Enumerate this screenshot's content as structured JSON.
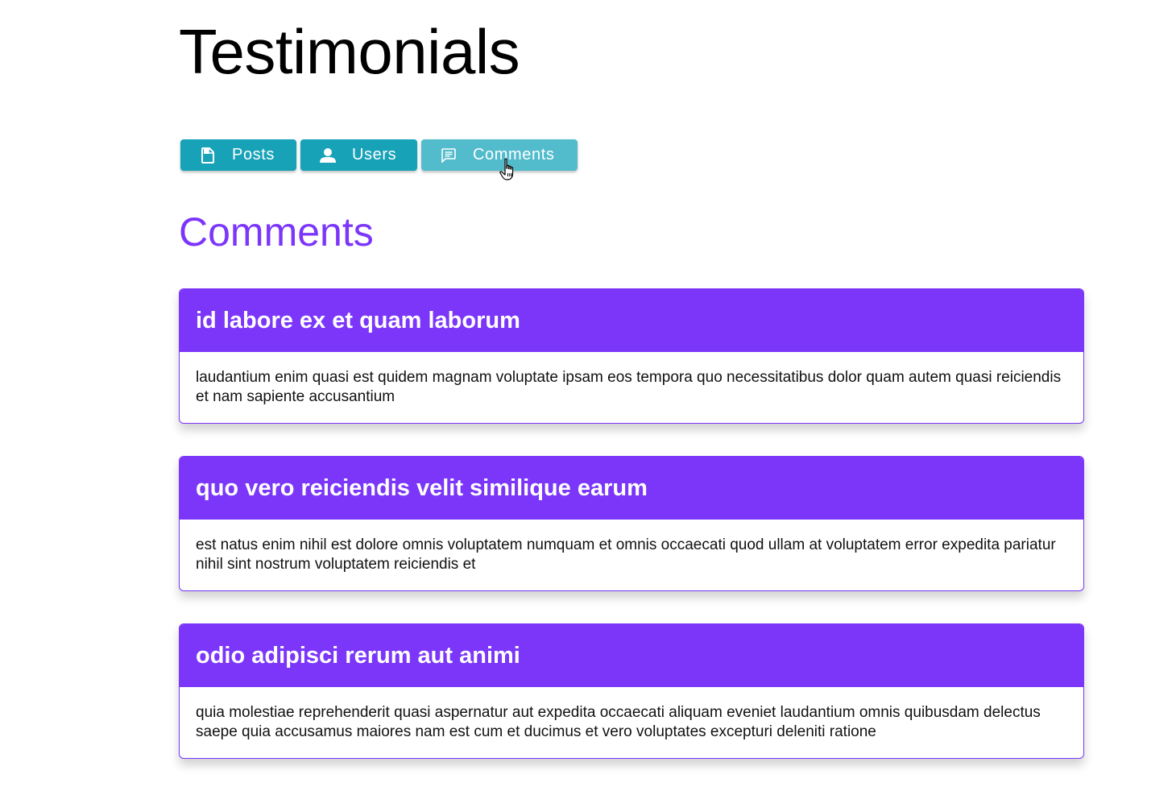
{
  "page": {
    "title": "Testimonials"
  },
  "tabs": [
    {
      "label": "Posts",
      "icon": "file-icon",
      "active": false
    },
    {
      "label": "Users",
      "icon": "user-icon",
      "active": false
    },
    {
      "label": "Comments",
      "icon": "comment-icon",
      "active": true
    }
  ],
  "section": {
    "heading": "Comments"
  },
  "comments": [
    {
      "title": "id labore ex et quam laborum",
      "body": "laudantium enim quasi est quidem magnam voluptate ipsam eos tempora quo necessitatibus dolor quam autem quasi reiciendis et nam sapiente accusantium"
    },
    {
      "title": "quo vero reiciendis velit similique earum",
      "body": "est natus enim nihil est dolore omnis voluptatem numquam et omnis occaecati quod ullam at voluptatem error expedita pariatur nihil sint nostrum voluptatem reiciendis et"
    },
    {
      "title": "odio adipisci rerum aut animi",
      "body": "quia molestiae reprehenderit quasi aspernatur aut expedita occaecati aliquam eveniet laudantium omnis quibusdam delectus saepe quia accusamus maiores nam est cum et ducimus et vero voluptates excepturi deleniti ratione"
    }
  ],
  "colors": {
    "accent": "#7b36f9",
    "tab": "#17a2b8",
    "tab_active": "#52bccc"
  }
}
